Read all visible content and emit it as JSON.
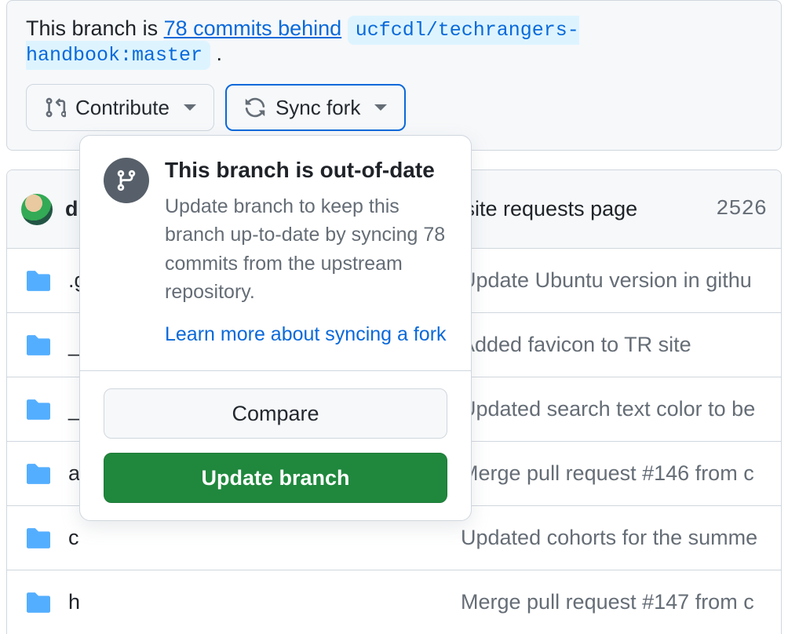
{
  "status": {
    "prefix": "This branch is ",
    "link_text": "78 commits behind",
    "repo_chip": "ucfcdl/techrangers-handbook:master",
    "suffix": " ."
  },
  "buttons": {
    "contribute": "Contribute",
    "sync_fork": "Sync fork"
  },
  "popover": {
    "title": "This branch is out-of-date",
    "body": "Update branch to keep this branch up-to-date by syncing 78 commits from the upstream repository.",
    "learn_more": "Learn more about syncing a fork",
    "compare": "Compare",
    "update": "Update branch"
  },
  "commit_header": {
    "author": "d",
    "message": "site requests page",
    "sha": "2526"
  },
  "files": [
    {
      "name": ".g",
      "message": "Update Ubuntu version in githu"
    },
    {
      "name": "_",
      "message": "Added favicon to TR site"
    },
    {
      "name": "_",
      "message": "Updated search text color to be"
    },
    {
      "name": "a",
      "message": "Merge pull request #146 from c"
    },
    {
      "name": "c",
      "message": "Updated cohorts for the summe"
    },
    {
      "name": "h",
      "message": "Merge pull request #147 from c"
    }
  ]
}
